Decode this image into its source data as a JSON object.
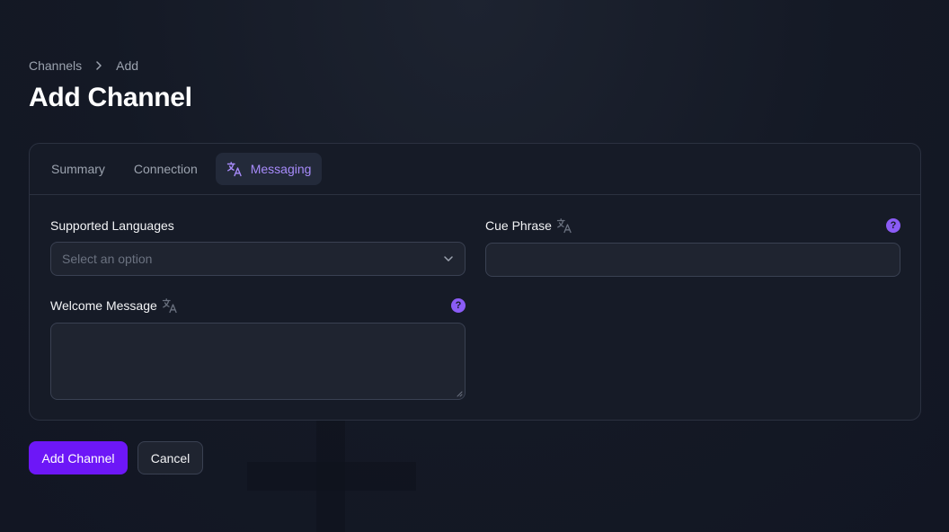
{
  "breadcrumb": {
    "items": [
      "Channels",
      "Add"
    ]
  },
  "page": {
    "title": "Add Channel"
  },
  "tabs": [
    {
      "label": "Summary",
      "active": false
    },
    {
      "label": "Connection",
      "active": false
    },
    {
      "label": "Messaging",
      "active": true,
      "icon": "translate-icon"
    }
  ],
  "form": {
    "supported_languages": {
      "label": "Supported Languages",
      "placeholder": "Select an option",
      "value": ""
    },
    "cue_phrase": {
      "label": "Cue Phrase",
      "value": "",
      "help": "?"
    },
    "welcome_message": {
      "label": "Welcome Message",
      "value": "",
      "help": "?"
    }
  },
  "actions": {
    "submit_label": "Add Channel",
    "cancel_label": "Cancel"
  },
  "colors": {
    "accent": "#8b5cf6",
    "primary_button": "#6d17f7",
    "background": "#141925",
    "card": "#161b27"
  }
}
